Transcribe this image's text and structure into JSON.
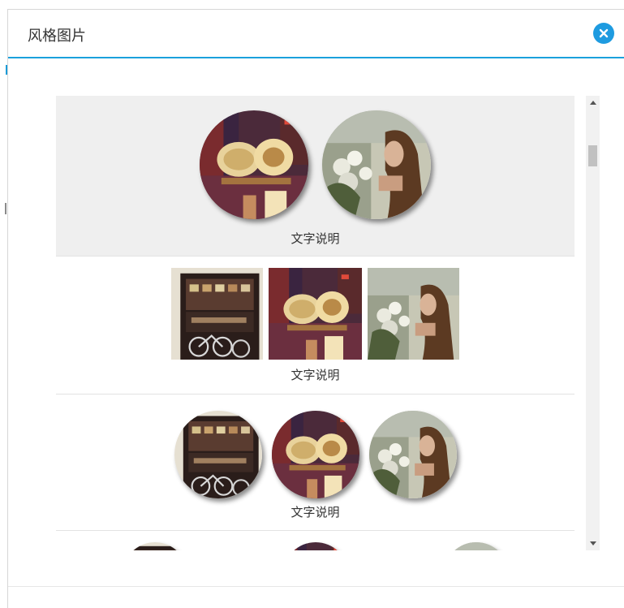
{
  "dialog": {
    "title": "风格图片",
    "close_icon": "close-icon"
  },
  "items": [
    {
      "caption": "文字说明",
      "style": "circles",
      "images": [
        "crafts",
        "girl"
      ],
      "selected": true
    },
    {
      "caption": "文字说明",
      "style": "squares",
      "images": [
        "shop",
        "crafts",
        "girl"
      ],
      "selected": false
    },
    {
      "caption": "文字说明",
      "style": "circles-shadow",
      "images": [
        "shop",
        "crafts",
        "girl"
      ],
      "selected": false
    }
  ],
  "colors": {
    "accent": "#1ba1dc",
    "selected_bg": "#efefef"
  }
}
